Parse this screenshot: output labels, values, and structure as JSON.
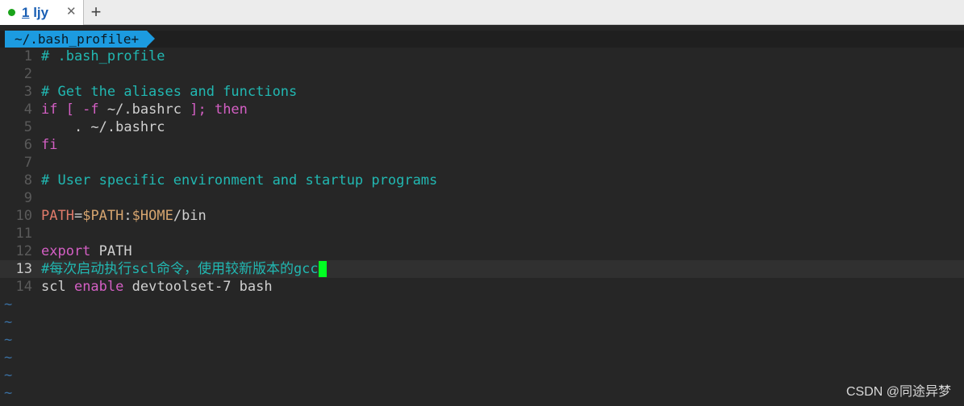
{
  "tabbar": {
    "tab_number": "1",
    "tab_title": "ljy",
    "close_glyph": "✕",
    "add_glyph": "+"
  },
  "statusline": {
    "filename": "~/.bash_profile+"
  },
  "lines": [
    {
      "num": "1",
      "tokens": [
        {
          "t": "# .bash_profile",
          "c": "comment"
        }
      ]
    },
    {
      "num": "2",
      "tokens": []
    },
    {
      "num": "3",
      "tokens": [
        {
          "t": "# Get the aliases and functions",
          "c": "comment"
        }
      ]
    },
    {
      "num": "4",
      "tokens": [
        {
          "t": "if [ -f ",
          "c": "kw"
        },
        {
          "t": "~/.bashrc",
          "c": "plain"
        },
        {
          "t": " ]; then",
          "c": "kw"
        }
      ]
    },
    {
      "num": "5",
      "tokens": [
        {
          "t": "    . ~/.bashrc",
          "c": "plain"
        }
      ]
    },
    {
      "num": "6",
      "tokens": [
        {
          "t": "fi",
          "c": "kw"
        }
      ]
    },
    {
      "num": "7",
      "tokens": []
    },
    {
      "num": "8",
      "tokens": [
        {
          "t": "# User specific environment and startup programs",
          "c": "comment"
        }
      ]
    },
    {
      "num": "9",
      "tokens": []
    },
    {
      "num": "10",
      "tokens": [
        {
          "t": "PATH",
          "c": "var"
        },
        {
          "t": "=",
          "c": "op"
        },
        {
          "t": "$PATH",
          "c": "dollar"
        },
        {
          "t": ":",
          "c": "op"
        },
        {
          "t": "$HOME",
          "c": "dollar"
        },
        {
          "t": "/bin",
          "c": "plain"
        }
      ]
    },
    {
      "num": "11",
      "tokens": []
    },
    {
      "num": "12",
      "tokens": [
        {
          "t": "export",
          "c": "kw"
        },
        {
          "t": " PATH",
          "c": "plain"
        }
      ]
    },
    {
      "num": "13",
      "tokens": [
        {
          "t": "#每次启动执行scl命令，使用较新版本的gcc",
          "c": "comment"
        }
      ],
      "current": true
    },
    {
      "num": "14",
      "tokens": [
        {
          "t": "scl ",
          "c": "plain"
        },
        {
          "t": "enable",
          "c": "kw"
        },
        {
          "t": " devtoolset-7 bash",
          "c": "plain"
        }
      ]
    }
  ],
  "tilde_rows": [
    "~",
    "~",
    "~",
    "~",
    "~",
    "~"
  ],
  "watermark": "CSDN @同途异梦",
  "colors": {
    "comment": "#21b8b2",
    "keyword": "#d45fc4",
    "cursor": "#00ff22",
    "statusline_tab": "#1c9be0"
  }
}
